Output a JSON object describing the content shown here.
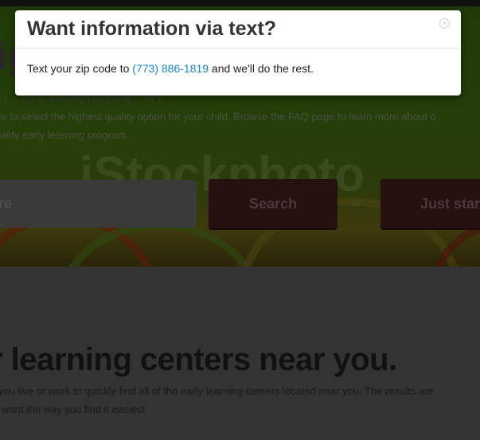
{
  "hero": {
    "title_partial": "ig",
    "text_lines": [
      "o's ... early learning programs ... or v",
      "de to select the highest quality option for your child. Browse the FAQ page to learn more about o",
      "uality early learning program."
    ],
    "watermark": "iStockphoto",
    "zip_input_value": "re",
    "search_label": "Search",
    "or_label": "or",
    "just_start_label": "Just star"
  },
  "section": {
    "title": "r learning centers near you.",
    "text_lines": [
      "you live or work to quickly find all of the early learning centers located near you. The results are",
      "want the way you find it easiest."
    ]
  },
  "modal": {
    "title": "Want information via text?",
    "close_icon": "close-circle-icon",
    "body_prefix": "Text your zip code to ",
    "phone": "(773) 886-1819",
    "body_suffix": " and we'll do the rest."
  }
}
